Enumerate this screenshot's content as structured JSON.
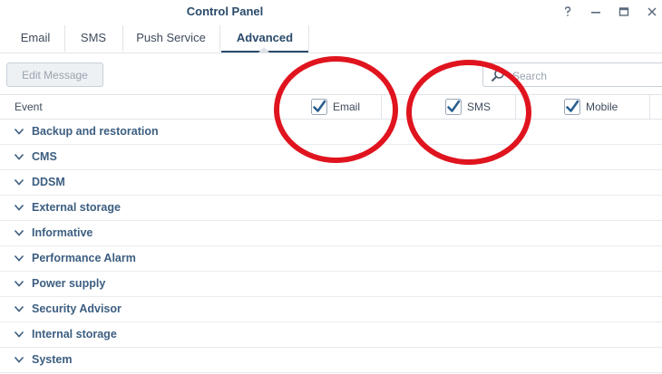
{
  "window": {
    "title": "Control Panel",
    "controls": [
      "help",
      "minimize",
      "maximize",
      "close"
    ]
  },
  "tabs": [
    {
      "label": "Email"
    },
    {
      "label": "SMS"
    },
    {
      "label": "Push Service"
    },
    {
      "label": "Advanced",
      "active": true
    }
  ],
  "toolbar": {
    "edit_message_label": "Edit Message",
    "search_placeholder": "Search"
  },
  "grid": {
    "event_header": "Event",
    "channels": [
      {
        "label": "Email",
        "checked": true
      },
      {
        "label": "SMS",
        "checked": true
      },
      {
        "label": "Mobile",
        "checked": true
      }
    ],
    "categories": [
      {
        "label": "Backup and restoration"
      },
      {
        "label": "CMS"
      },
      {
        "label": "DDSM"
      },
      {
        "label": "External storage"
      },
      {
        "label": "Informative"
      },
      {
        "label": "Performance Alarm"
      },
      {
        "label": "Power supply"
      },
      {
        "label": "Security Advisor"
      },
      {
        "label": "Internal storage"
      },
      {
        "label": "System"
      }
    ]
  },
  "colors": {
    "accent": "#2a4a6b",
    "category_text": "#3c5e80",
    "checkmark": "#2a5f8f",
    "annotation": "#e0141e"
  }
}
